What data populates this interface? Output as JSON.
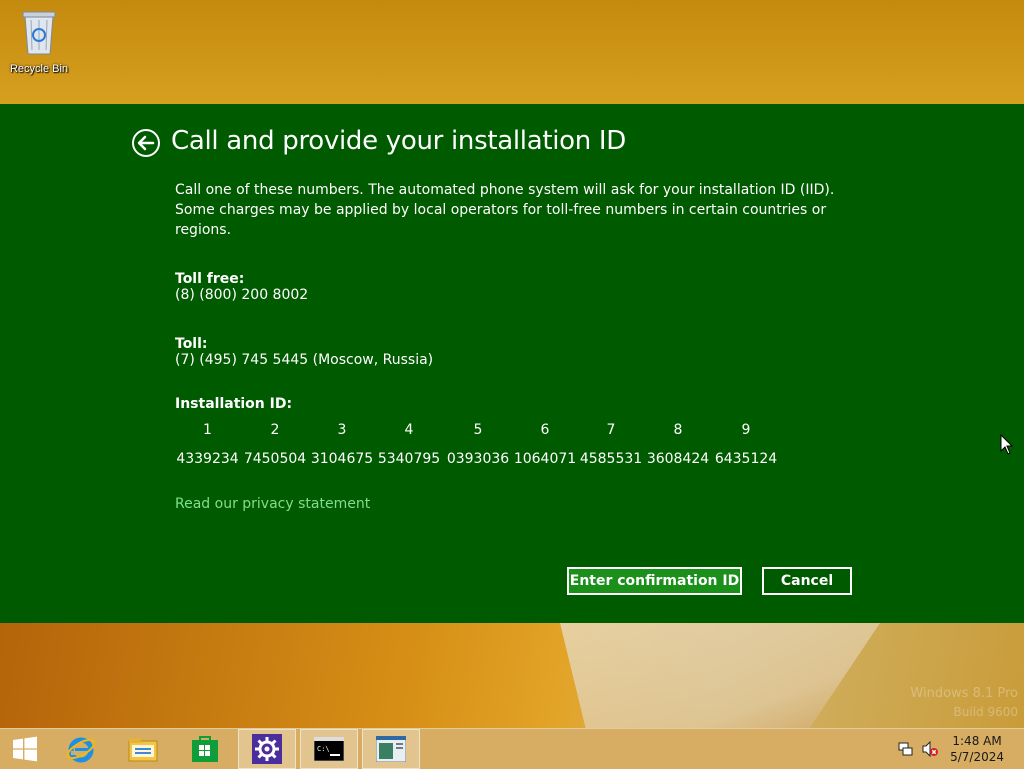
{
  "desktop": {
    "recycle_bin_label": "Recycle Bin",
    "watermark_line1": "Windows 8.1 Pro",
    "watermark_line2": "Build 9600"
  },
  "dialog": {
    "title": "Call and provide your installation ID",
    "description": "Call one of these numbers. The automated phone system will ask for your installation ID (IID). Some charges may be applied by local operators for toll-free numbers in certain countries or regions.",
    "toll_free_label": "Toll free:",
    "toll_free_number": "(8) (800) 200 8002",
    "toll_label": "Toll:",
    "toll_number": "(7) (495) 745 5445 (Moscow, Russia)",
    "installation_id_label": "Installation ID:",
    "iid_columns": [
      "1",
      "2",
      "3",
      "4",
      "5",
      "6",
      "7",
      "8",
      "9"
    ],
    "iid_values": [
      "4339234",
      "7450504",
      "3104675",
      "5340795",
      "0393036",
      "1064071",
      "4585531",
      "3608424",
      "6435124"
    ],
    "privacy_link": "Read our privacy statement",
    "enter_confirmation_button": "Enter confirmation ID",
    "cancel_button": "Cancel"
  },
  "taskbar": {
    "items": [
      "start-icon",
      "internet-explorer-icon",
      "file-explorer-icon",
      "store-icon",
      "settings-icon",
      "command-prompt-icon",
      "activation-window-icon"
    ],
    "clock_time": "1:48 AM",
    "clock_date": "5/7/2024"
  },
  "colors": {
    "dialog_bg": "#005a00",
    "primary_button": "#1a8f1a",
    "link": "#7ee08a"
  }
}
